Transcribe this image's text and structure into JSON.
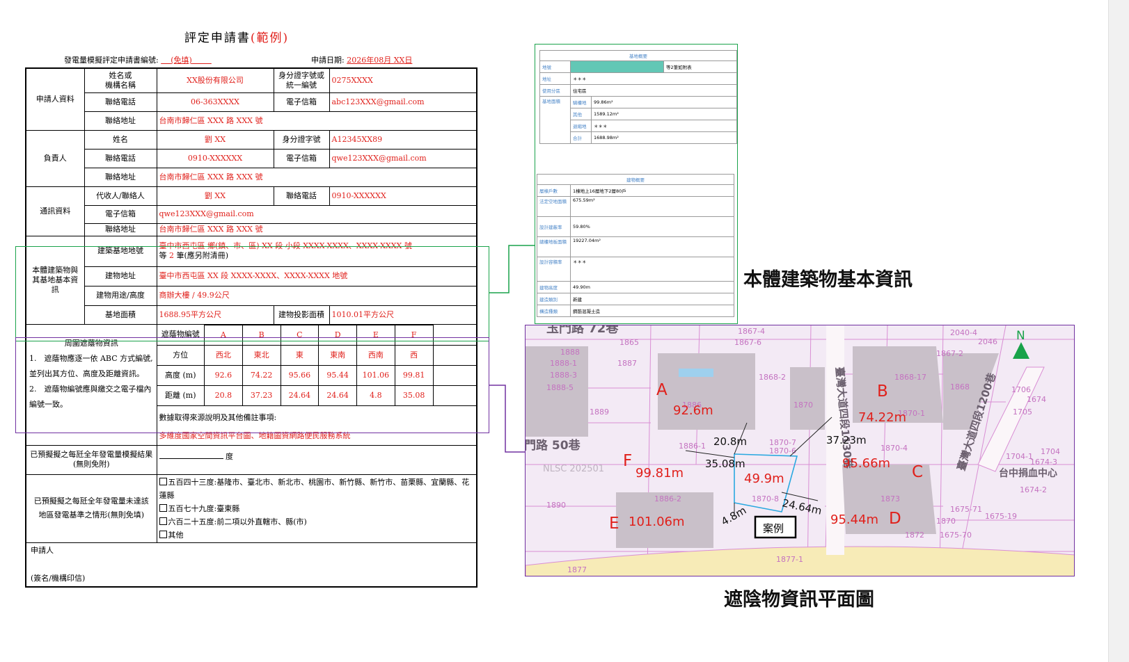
{
  "form": {
    "title_main": "評定申請書",
    "title_suffix": "(範例)",
    "app_no_label": "發電量模擬評定申請書編號:",
    "app_no_value": "(免填)",
    "date_label": "申請日期:",
    "date_value": "2026年08月 XX日",
    "applicant": {
      "section": "申請人資料",
      "name_label": "姓名或\n機構名稱",
      "name_value": "XX股份有限公司",
      "id_label": "身分證字號或\n統一編號",
      "id_value": "0275XXXX",
      "phone_label": "聯絡電話",
      "phone_value": "06-363XXXX",
      "email_label": "電子信箱",
      "email_value": "abc123XXX@gmail.com",
      "addr_label": "聯絡地址",
      "addr_value": "台南市歸仁區 XXX 路 XXX 號"
    },
    "responsible": {
      "section": "負責人",
      "name_label": "姓名",
      "name_value": "劉 XX",
      "id_label": "身分證字號",
      "id_value": "A12345XX89",
      "phone_label": "聯絡電話",
      "phone_value": "0910-XXXXXX",
      "email_label": "電子信箱",
      "email_value": "qwe123XXX@gmail.com",
      "addr_label": "聯絡地址",
      "addr_value": "台南市歸仁區 XXX 路 XXX 號"
    },
    "contact": {
      "section": "通訊資料",
      "agent_label": "代收人/聯絡人",
      "agent_value": "劉 XX",
      "phone_label": "聯絡電話",
      "phone_value": "0910-XXXXXX",
      "email_label": "電子信箱",
      "email_value": "qwe123XXX@gmail.com",
      "addr_label": "聯絡地址",
      "addr_value": "台南市歸仁區 XXX 路 XXX 號"
    },
    "building": {
      "section": "本體建築物與\n其基地基本資\n訊",
      "lot_label": "建築基地地號",
      "lot_line1": "臺中市西屯區 鄉(鎮、市、區) XX 段 小段 XXXX-XXXX、XXXX-XXXX 號",
      "lot_line2_pre": "等",
      "lot_line2_num": "2",
      "lot_line2_post": "筆(應另附清冊)",
      "addr_label": "建物地址",
      "addr_value": "臺中市西屯區 XX 段 XXXX-XXXX、XXXX-XXXX 地號",
      "use_label": "建物用途/高度",
      "use_value": "商辦大樓 / 49.9公尺",
      "area_label": "基地面積",
      "area_value": "1688.95平方公尺",
      "proj_label": "建物投影面積",
      "proj_value": "1010.01平方公尺"
    },
    "shading": {
      "title": "周圍遮蔭物資訊",
      "note1": "1.　遮蔭物應逐一依 ABC 方式編號,並列出其方位、高度及距離資訊。",
      "note2": "2.　遮蔭物編號應與繳交之電子檔內編號一致。",
      "id_label": "遮蔭物編號",
      "dir_label": "方位",
      "height_label": "高度 (m)",
      "dist_label": "距離 (m)",
      "ids": [
        "A",
        "B",
        "C",
        "D",
        "E",
        "F"
      ],
      "directions": [
        "西北",
        "東北",
        "東",
        "東南",
        "西南",
        "西"
      ],
      "heights": [
        "92.6",
        "74.22",
        "95.66",
        "95.44",
        "101.06",
        "99.81"
      ],
      "distances": [
        "20.8",
        "37.23",
        "24.64",
        "24.64",
        "4.8",
        "35.08"
      ],
      "source_label": "數據取得來源說明及其他備註事項:",
      "source_value": "多維度國家空間資訊平台圖、地籍圖資網路便民服務系統"
    },
    "simulated_label": "已預擬擬之每瓩全年發電量模擬結果(無則免附)",
    "simulated_unit": "度",
    "below_label": "已預擬擬之每瓩全年發電量未達該地區發電基準之情形(無則免填)",
    "options": [
      "五百四十三度:基隆市、臺北市、新北市、桃園市、新竹縣、新竹市、苗栗縣、宜蘭縣、花蓮縣",
      "五百七十九度:臺東縣",
      "六百二十五度:前二項以外直轄市、縣(市)",
      "其他"
    ],
    "signer_label": "申請人",
    "sign_note": "(簽名/機構印信)"
  },
  "building_panel": {
    "site_header": "基地概要",
    "site_rows": [
      {
        "label": "地號",
        "value": "",
        "extra": "等2筆如附表"
      },
      {
        "label": "地址",
        "value": "＊＊＊"
      },
      {
        "label": "使用分區",
        "value": "住宅區"
      }
    ],
    "area_label": "基地面積",
    "area_rows": [
      {
        "label": "騎樓地",
        "value": "99.86m²"
      },
      {
        "label": "其他",
        "value": "1589.12m²"
      },
      {
        "label": "退縮地",
        "value": "＊＊＊"
      },
      {
        "label": "合計",
        "value": "1688.98m²"
      }
    ],
    "bldg_header": "建物概要",
    "bldg_rows": [
      {
        "label": "層棟戶數",
        "value": "1棟地上16層地下2層80戶"
      },
      {
        "label": "法定空地面積",
        "value": "675.59m²"
      },
      {
        "label": "設計建蔽率",
        "value": "59.80%"
      },
      {
        "label": "總樓地板面積",
        "value": "19227.04m²"
      },
      {
        "label": "設計容積率",
        "value": "＊＊＊"
      },
      {
        "label": "建物高度",
        "value": "49.90m"
      },
      {
        "label": "建造類別",
        "value": "新建"
      },
      {
        "label": "構造種類",
        "value": "鋼筋混凝土造"
      }
    ]
  },
  "captions": {
    "building_info": "本體建築物基本資訊",
    "map_title": "遮陰物資訊平面圖"
  },
  "map": {
    "north": "N",
    "roads": [
      "玉門路 72巷",
      "門路 50巷",
      "臺灣大道四段1130巷",
      "臺灣大道四段1200巷",
      "台中捐血中心"
    ],
    "parcels": [
      "1867-4",
      "1867-6",
      "1865",
      "1888",
      "1888-1",
      "1888-3",
      "1888-5",
      "1887",
      "1868-2",
      "1886",
      "1889",
      "1870",
      "1868-17",
      "1868",
      "1870-1",
      "2040-4",
      "2046",
      "1867-2",
      "1886-1",
      "1870-7",
      "1870-6",
      "1870-4",
      "1886-2",
      "1870-8",
      "1890",
      "1873",
      "1675-71",
      "1675-19",
      "1870",
      "1675-70",
      "1872",
      "1877",
      "1877-1",
      "1674",
      "1674-2",
      "1674-3",
      "1704-1",
      "1704",
      "1705",
      "1706"
    ],
    "watermark": "NLSC 202501",
    "buildings": [
      {
        "id": "A",
        "height": "92.6m"
      },
      {
        "id": "B",
        "height": "74.22m"
      },
      {
        "id": "C",
        "height": "95.66m"
      },
      {
        "id": "D",
        "height": "95.44m"
      },
      {
        "id": "E",
        "height": "101.06m"
      },
      {
        "id": "F",
        "height": "99.81m"
      }
    ],
    "distances": [
      "20.8m",
      "37.23m",
      "35.08m",
      "24.64m",
      "4.8m"
    ],
    "case_height": "49.9m",
    "case_label": "案例"
  }
}
